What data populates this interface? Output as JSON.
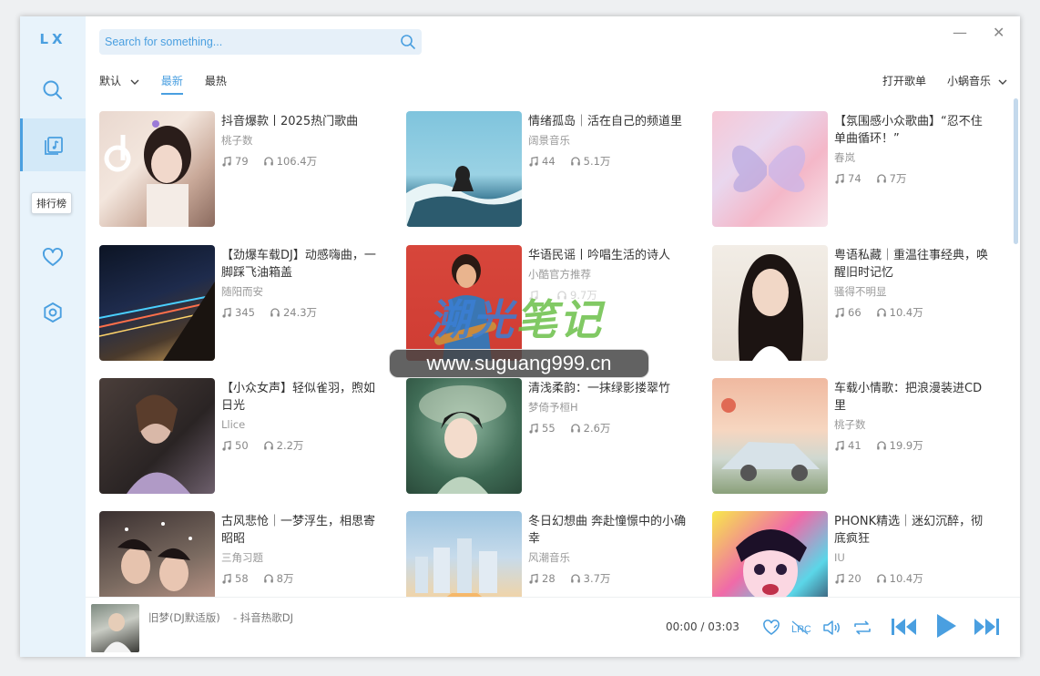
{
  "app": {
    "logo": "LX"
  },
  "window": {
    "minimize": "—",
    "close": "✕"
  },
  "sidebar": {
    "tooltip": "排行榜"
  },
  "search": {
    "placeholder": "Search for something..."
  },
  "tabs": {
    "sort_default": "默认",
    "newest": "最新",
    "hottest": "最热"
  },
  "header": {
    "open_playlist": "打开歌单",
    "source": "小蜗音乐"
  },
  "playlists": [
    {
      "title": "抖音爆款丨2025热门歌曲",
      "author": "桃子数",
      "songs": "79",
      "plays": "106.4万"
    },
    {
      "title": "情绪孤岛｜活在自己的频道里",
      "author": "阔景音乐",
      "songs": "44",
      "plays": "5.1万"
    },
    {
      "title": "【氛围感小众歌曲】“忍不住单曲循环！”",
      "author": "春岚",
      "songs": "74",
      "plays": "7万"
    },
    {
      "title": "【劲爆车载DJ】动感嗨曲，一脚踩飞油箱盖",
      "author": "随阳而安",
      "songs": "345",
      "plays": "24.3万"
    },
    {
      "title": "华语民谣丨吟唱生活的诗人",
      "author": "小酷官方推荐",
      "songs": "",
      "plays": "9.7万"
    },
    {
      "title": "粤语私藏｜重温往事经典，唤醒旧时记忆",
      "author": "骚得不明显",
      "songs": "66",
      "plays": "10.4万"
    },
    {
      "title": "【小众女声】轻似雀羽，煦如日光",
      "author": "Llice",
      "songs": "50",
      "plays": "2.2万"
    },
    {
      "title": "清浅柔韵：一抹绿影搂翠竹",
      "author": "梦倚予桓H",
      "songs": "55",
      "plays": "2.6万"
    },
    {
      "title": "车载小情歌：把浪漫装进CD里",
      "author": "桃子数",
      "songs": "41",
      "plays": "19.9万"
    },
    {
      "title": "古风悲怆｜一梦浮生，相思寄昭昭",
      "author": "三角习题",
      "songs": "58",
      "plays": "8万"
    },
    {
      "title": "冬日幻想曲 奔赴憧憬中的小确幸",
      "author": "风潮音乐",
      "songs": "28",
      "plays": "3.7万"
    },
    {
      "title": "PHONK精选｜迷幻沉醉，彻底疯狂",
      "author": "IU",
      "songs": "20",
      "plays": "10.4万"
    }
  ],
  "player": {
    "song": "旧梦(DJ默适版)",
    "artist": "- 抖音热歌DJ",
    "time": "00:00 / 03:03"
  },
  "watermark": {
    "cn_a": "溯光",
    "cn_b": "笔记",
    "url": "www.suguang999.cn"
  }
}
